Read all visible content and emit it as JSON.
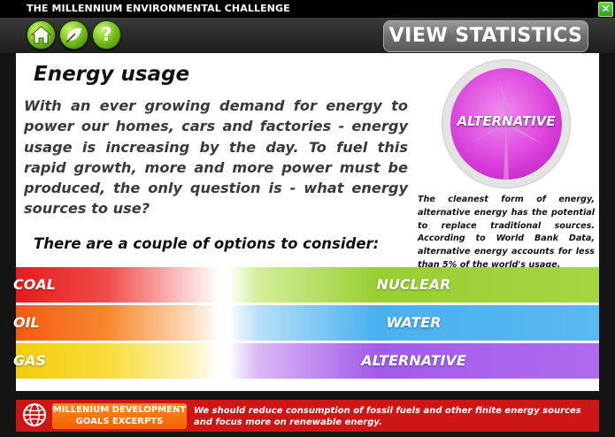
{
  "window": {
    "title": "THE MILLENNIUM ENVIRONMENTAL CHALLENGE",
    "close_label": "✕"
  },
  "toolbar": {
    "buttons": [
      {
        "name": "home-icon"
      },
      {
        "name": "leaf-icon"
      },
      {
        "name": "help-icon",
        "label": "?"
      }
    ],
    "stats_label": "VIEW STATISTICS"
  },
  "main": {
    "heading": "Energy usage",
    "intro": "With an ever growing demand for energy to power our homes, cars and factories - energy usage is increasing by the day. To fuel this rapid growth, more and more power must be produced, the only question is - what energy sources to use?",
    "options_heading": "There are a couple of options to consider:",
    "badge": {
      "label": "ALTERNATIVE",
      "description": "The cleanest form of energy, alternative energy has the potential to replace traditional sources. According to World Bank Data, alternative energy accounts for less than 5% of the world's usage."
    },
    "options_left": [
      {
        "label": "COAL",
        "color": "#e51b1b"
      },
      {
        "label": "OIL",
        "color": "#f45a10"
      },
      {
        "label": "GAS",
        "color": "#f2cc0e"
      }
    ],
    "options_right": [
      {
        "label": "NUCLEAR",
        "color": "#97cf31"
      },
      {
        "label": "WATER",
        "color": "#4ab0ee"
      },
      {
        "label": "ALTERNATIVE",
        "color": "#a35bea"
      }
    ]
  },
  "footer": {
    "tag": "MILLENIUM DEVELOPMENT GOALS EXCERPTS",
    "text": "We should reduce consumption of fossil fuels and other finite energy sources and focus more on renewable energy."
  }
}
